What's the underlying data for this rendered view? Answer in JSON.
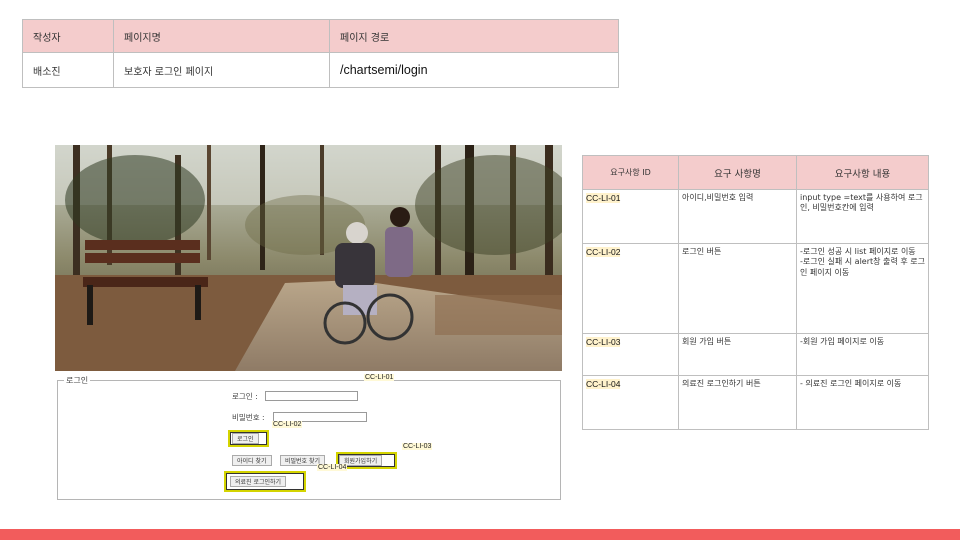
{
  "info_table": {
    "headers": [
      "작성자",
      "페이지명",
      "페이지 경로"
    ],
    "author": "배소진",
    "page_name": "보호자 로그인 페이지",
    "page_path": "/chartsemi/login"
  },
  "login_form": {
    "legend": "로그인",
    "id_label": "로그인 :",
    "pw_label": "비밀번호 :",
    "login_button": "로그인",
    "find_id_button": "아이디 찾기",
    "find_pw_button": "비밀번호 찾기",
    "signup_button": "회원가입하기",
    "medical_login_button": "의료진 로그인하기"
  },
  "callouts": {
    "li01": "CC-LI-01",
    "li02": "CC-LI-02",
    "li03": "CC-LI-03",
    "li04": "CC-LI-04"
  },
  "requirements": {
    "headers": [
      "요구사항 ID",
      "요구 사항명",
      "요구사항 내용"
    ],
    "rows": [
      {
        "id": "CC-LI-01",
        "name": "아이디,비밀번호 입력",
        "desc": "input type =text를 사용하여 로그인, 비밀번호칸에 입력"
      },
      {
        "id": "CC-LI-02",
        "name": "로그인 버튼",
        "desc": "-로그인 성공 시 list 페이지로 이동\n-로그인 실패 시 alert창 출력 후 로그인 페이지 이동"
      },
      {
        "id": "CC-LI-03",
        "name": "회원 가입 버튼",
        "desc": "-회원 가입 페이지로 이동"
      },
      {
        "id": "CC-LI-04",
        "name": "의료진 로그인하기 버튼",
        "desc": "- 의료진 로그인 페이지로 이동"
      }
    ]
  },
  "colors": {
    "header_fill": "#f4cccc",
    "highlight": "#d4d400",
    "id_highlight": "#fff2cc",
    "bottom_bar": "#f25c5c"
  }
}
